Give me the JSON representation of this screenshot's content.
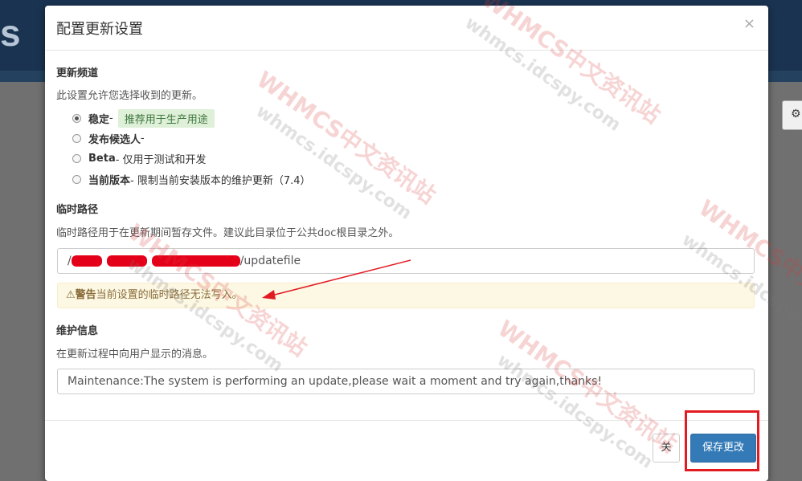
{
  "background": {
    "logo_text": "s",
    "gear_glyph": "⚙"
  },
  "modal": {
    "title": "配置更新设置",
    "close_glyph": "×",
    "update_channel": {
      "title": "更新频道",
      "help": "此设置允许您选择收到的更新。",
      "options": [
        {
          "label": "稳定",
          "suffix": " -",
          "badge": "推荐用于生产用途",
          "checked": true
        },
        {
          "label": "发布候选人",
          "suffix": " -",
          "checked": false
        },
        {
          "label": "Beta",
          "suffix": " - 仅用于测试和开发",
          "checked": false
        },
        {
          "label": "当前版本",
          "suffix": " - 限制当前安装版本的维护更新（7.4）",
          "checked": false
        }
      ]
    },
    "temp_path": {
      "title": "临时路径",
      "help": "临时路径用于在更新期间暂存文件。建议此目录位于公共doc根目录之外。",
      "value_prefix": "/",
      "value_visible_suffix": "/updatefile",
      "warning_icon": "⚠",
      "warning_label": "警告",
      "warning_text": "当前设置的临时路径无法写入。"
    },
    "maintenance": {
      "title": "维护信息",
      "help": "在更新过程中向用户显示的消息。",
      "value": "Maintenance:The system is performing an update,please wait a moment and try again,thanks!"
    },
    "footer": {
      "close_label": "关",
      "save_label": "保存更改"
    }
  },
  "colors": {
    "primary": "#337ab7",
    "warning_bg": "#fcf8e3",
    "annotation_red": "#e21b23",
    "success_bg": "#dff0d8"
  },
  "watermarks": {
    "brand": "WHMCS中文资讯站",
    "site": "whmcs.idcspy.com"
  }
}
